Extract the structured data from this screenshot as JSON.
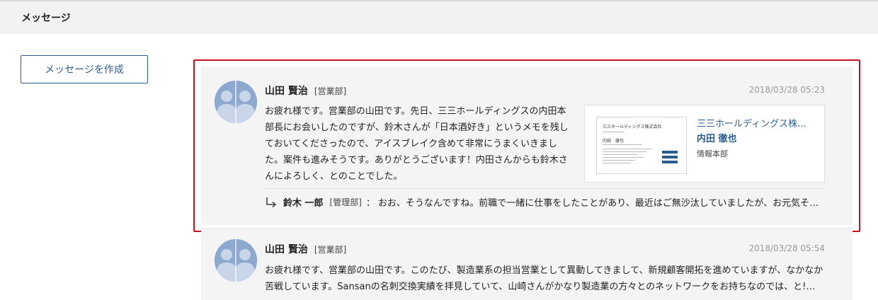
{
  "header": {
    "title": "メッセージ"
  },
  "compose": {
    "label": "メッセージを作成"
  },
  "messages": [
    {
      "sender_name": "山田 賢治",
      "sender_dept": "[営業部]",
      "timestamp": "2018/03/28 05:23",
      "body": "お疲れ様です。営業部の山田です。先日、三三ホールディングスの内田本部長にお会いしたのですが、鈴木さんが「日本酒好き」というメモを残しておいてくださったので、アイスブレイク含めて非常にうまくいきました。案件も進みそうです。ありがとうございます！内田さんからも鈴木さんによろしく、とのことでした。",
      "card": {
        "company": "三三ホールディングス株…",
        "person": "内田 徹也",
        "department": "情報本部",
        "image_company": "三三ホールディングス株式会社",
        "image_name": "内田　徹也"
      },
      "reply": {
        "name": "鈴木 一郎",
        "dept": "[管理部]",
        "separator": "：",
        "text": "おお、そうなんですね。前職で一緒に仕事をしたことがあり、最近はご無沙汰していましたが、お元気そう…"
      }
    },
    {
      "sender_name": "山田 賢治",
      "sender_dept": "[営業部]",
      "timestamp": "2018/03/28 05:54",
      "body": "お疲れ様です、営業部の山田です。このたび、製造業系の担当営業として異動してきまして、新規顧客開拓を進めていますが、なかなか苦戦しています。Sansanの名刺交換実績を拝見していて、山崎さんがかなり製造業の方々とのネットワークをお持ちなのでは、と!…"
    }
  ],
  "colors": {
    "accent": "#2a5d8f",
    "highlight": "#c8101e",
    "avatar": "#8ea9cf"
  },
  "icons": {
    "avatar": "group-avatar-icon",
    "reply": "reply-arrow-icon",
    "card_logo": "company-logo-icon"
  }
}
